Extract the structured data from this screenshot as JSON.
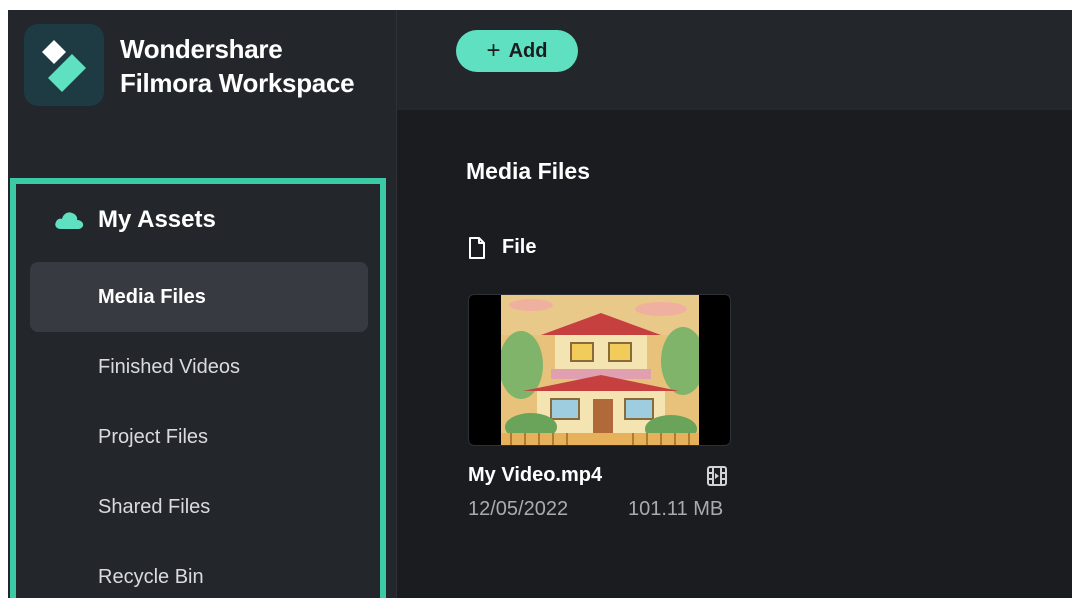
{
  "brand": {
    "line1": "Wondershare",
    "line2": "Filmora Workspace",
    "logo_icon": "filmora-diamond-logo"
  },
  "toolbar": {
    "add_label": "Add",
    "add_icon": "plus-icon"
  },
  "sidebar": {
    "section_icon": "cloud-icon",
    "section_label": "My Assets",
    "items": [
      {
        "label": "Media Files",
        "active": true
      },
      {
        "label": "Finished Videos",
        "active": false
      },
      {
        "label": "Project Files",
        "active": false
      },
      {
        "label": "Shared Files",
        "active": false
      },
      {
        "label": "Recycle Bin",
        "active": false
      }
    ]
  },
  "main": {
    "title": "Media Files",
    "group_label": "File",
    "group_icon": "file-icon",
    "files": [
      {
        "name": "My Video.mp4",
        "date": "12/05/2022",
        "size": "101.11 MB",
        "type_icon": "video-file-icon"
      }
    ]
  },
  "colors": {
    "accent": "#5fe0c0",
    "highlight_border": "#3cc9a6",
    "background": "#1a1c20",
    "panel": "#23262b"
  }
}
